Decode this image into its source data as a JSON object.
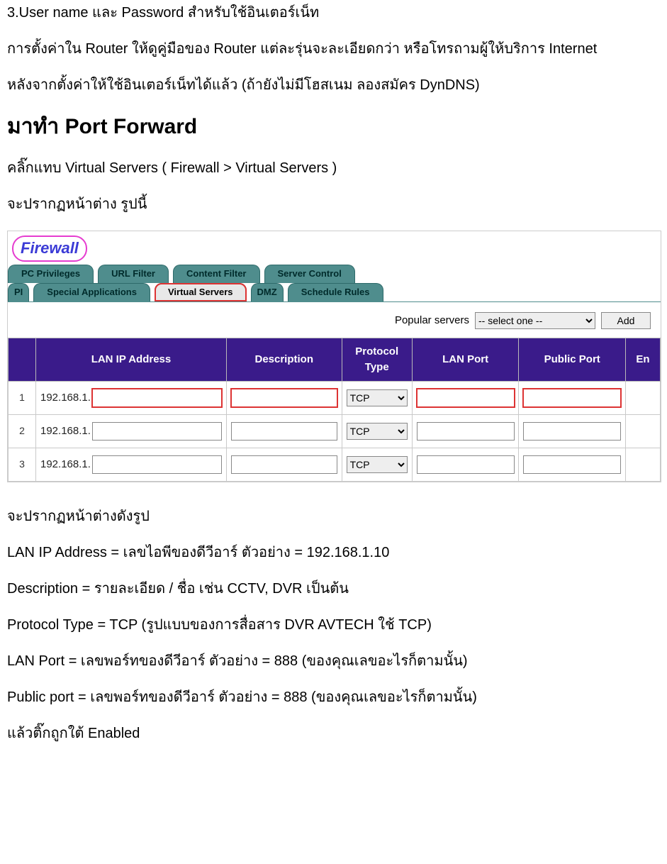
{
  "intro": {
    "line1": "3.User name และ Password สำหรับใช้อินเตอร์เน็ท",
    "line2": "การตั้งค่าใน Router ให้ดูคู่มือของ Router แต่ละรุ่นจะละเอียดกว่า หรือโทรถามผู้ให้บริการ Internet",
    "line3": "หลังจากตั้งค่าให้ใช้อินเตอร์เน็ทได้แล้ว (ถ้ายังไม่มีโฮสเนม ลองสมัคร DynDNS)"
  },
  "heading": "มาทำ Port Forward",
  "preshot": {
    "click": "คลิ๊กแทบ Virtual Servers ( Firewall > Virtual Servers )",
    "appear": "จะปรากฏหน้าต่าง รูปนี้"
  },
  "shot": {
    "badge": "Firewall",
    "tabs_row1": [
      "PC Privileges",
      "URL Filter",
      "Content Filter",
      "Server Control"
    ],
    "tabs_row2_leading": [
      "PI",
      "Special Applications"
    ],
    "tabs_row2_active": "Virtual Servers",
    "tabs_row2_trailing": [
      "DMZ",
      "Schedule Rules"
    ],
    "popular_label": "Popular servers",
    "popular_selected": "-- select one --",
    "add_btn": "Add",
    "cols": {
      "lanip": "LAN IP Address",
      "desc": "Description",
      "ptype": "Protocol Type",
      "lanport": "LAN Port",
      "pubport": "Public Port",
      "en": "En"
    },
    "rows": [
      {
        "n": "1",
        "prefix": "192.168.1.",
        "ptype": "TCP",
        "ring": true
      },
      {
        "n": "2",
        "prefix": "192.168.1.",
        "ptype": "TCP",
        "ring": false
      },
      {
        "n": "3",
        "prefix": "192.168.1.",
        "ptype": "TCP",
        "ring": false
      }
    ]
  },
  "outro": {
    "l1": "จะปรากฏหน้าต่างดังรูป",
    "l2": "LAN IP Address = เลขไอพีของดีวีอาร์ ตัวอย่าง = 192.168.1.10",
    "l3": "Description = รายละเอียด / ชื่อ เช่น CCTV, DVR เป็นต้น",
    "l4": "Protocol Type = TCP (รูปแบบของการสื่อสาร DVR AVTECH ใช้ TCP)",
    "l5": "LAN Port = เลขพอร์ทของดีวีอาร์ ตัวอย่าง = 888 (ของคุณเลขอะไรก็ตามนั้น)",
    "l6": "Public port = เลขพอร์ทของดีวีอาร์ ตัวอย่าง = 888 (ของคุณเลขอะไรก็ตามนั้น)",
    "l7": "แล้วติ๊กถูกใต้ Enabled"
  }
}
